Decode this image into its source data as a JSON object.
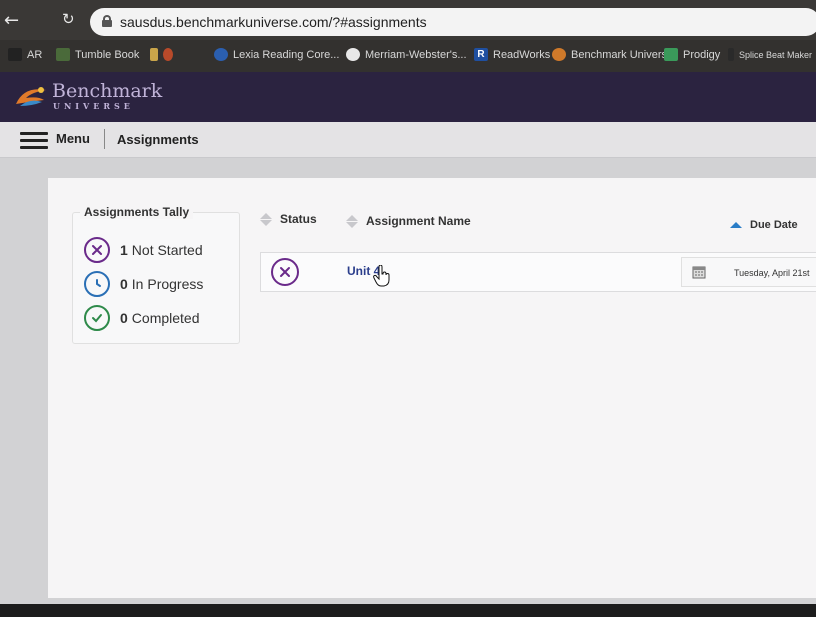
{
  "browser": {
    "url": "sausdus.benchmarkuniverse.com/?#assignments",
    "bookmarks": [
      {
        "label": "AR",
        "icon": "ar-icon"
      },
      {
        "label": "Tumble Book",
        "icon": "tumblebook-icon"
      },
      {
        "label": "Lexia Reading Core...",
        "icon": "lexia-icon"
      },
      {
        "label": "Merriam-Webster's...",
        "icon": "merriam-webster-icon"
      },
      {
        "label": "ReadWorks",
        "icon": "readworks-icon"
      },
      {
        "label": "Benchmark Universe",
        "icon": "benchmark-icon"
      },
      {
        "label": "Prodigy",
        "icon": "prodigy-icon"
      },
      {
        "label": "Splice Beat Maker",
        "icon": "splice-icon"
      }
    ]
  },
  "app": {
    "logo_text": "Benchmark",
    "logo_sub": "UNIVERSE",
    "menu_label": "Menu",
    "page_title": "Assignments"
  },
  "tally": {
    "title": "Assignments Tally",
    "rows": [
      {
        "count": "1",
        "label": "Not Started",
        "icon": "not-started-icon",
        "color": "#6a2a8a"
      },
      {
        "count": "0",
        "label": "In Progress",
        "icon": "in-progress-icon",
        "color": "#2a6fb5"
      },
      {
        "count": "0",
        "label": "Completed",
        "icon": "completed-icon",
        "color": "#2e8a4a"
      }
    ]
  },
  "table": {
    "headers": {
      "status": "Status",
      "name": "Assignment Name",
      "due": "Due Date"
    },
    "rows": [
      {
        "status_icon": "not-started-icon",
        "name": "Unit 4",
        "due": "Tuesday, April 21st"
      }
    ]
  },
  "colors": {
    "header_bg": "#2b2340",
    "link": "#2b3e8c",
    "accent": "#2a7dc7"
  }
}
